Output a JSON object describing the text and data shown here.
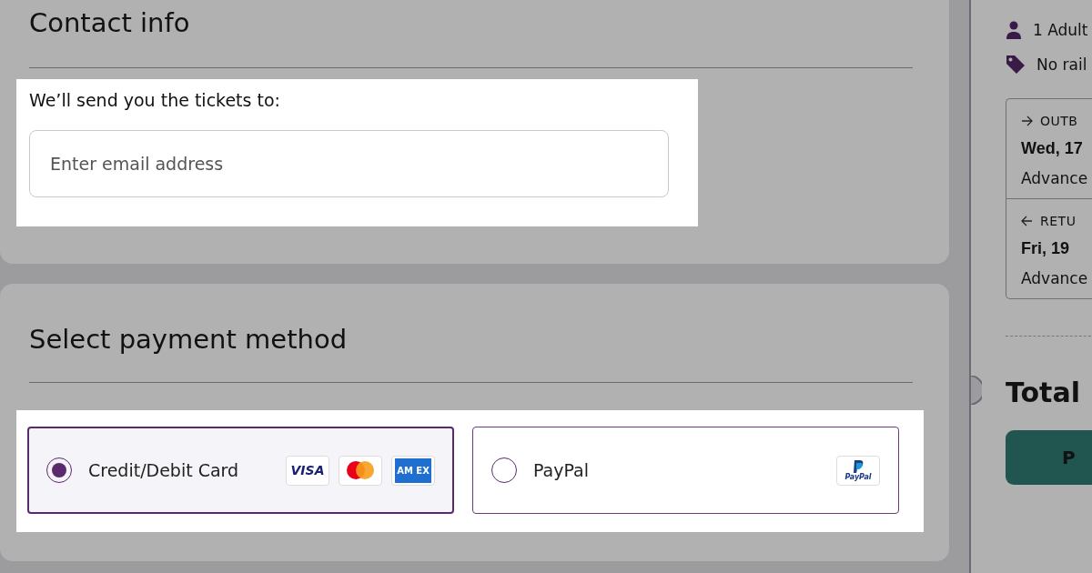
{
  "contact": {
    "title": "Contact info",
    "prompt": "We’ll send you the tickets to:",
    "email": {
      "placeholder": "Enter email address"
    }
  },
  "payment": {
    "title": "Select payment method",
    "methods": [
      {
        "label": "Credit/Debit Card",
        "selected": true,
        "logos": [
          {
            "kind": "visa",
            "text": "VISA"
          },
          {
            "kind": "mastercard"
          },
          {
            "kind": "amex",
            "text": "AM EX"
          }
        ]
      },
      {
        "label": "PayPal",
        "selected": false,
        "logos": [
          {
            "kind": "paypal",
            "text": "PayPal"
          }
        ]
      }
    ]
  },
  "summary": {
    "passengers": "1 Adult",
    "railcard": "No rail",
    "journeys": [
      {
        "kind": "outbound",
        "direction": "OUTB",
        "date": "Wed, 17",
        "fare": "Advance"
      },
      {
        "kind": "return",
        "direction": "RETU",
        "date": "Fri, 19",
        "fare": "Advance"
      }
    ],
    "total_label": "Total",
    "pay_button": "P"
  }
}
